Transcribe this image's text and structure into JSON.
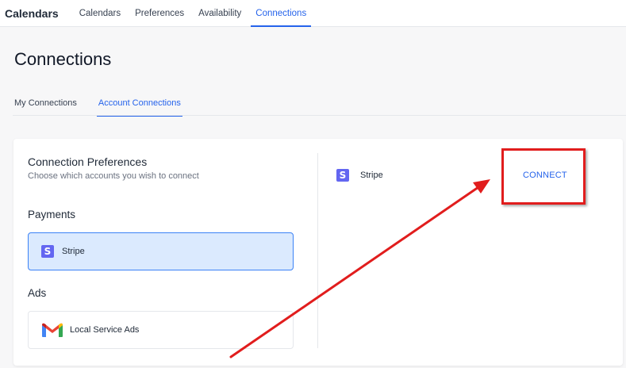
{
  "app": {
    "title": "Calendars"
  },
  "topnav": {
    "tabs": [
      {
        "label": "Calendars",
        "active": false
      },
      {
        "label": "Preferences",
        "active": false
      },
      {
        "label": "Availability",
        "active": false
      },
      {
        "label": "Connections",
        "active": true
      }
    ]
  },
  "page": {
    "title": "Connections"
  },
  "subtabs": [
    {
      "label": "My Connections",
      "active": false
    },
    {
      "label": "Account Connections",
      "active": true
    }
  ],
  "preferences": {
    "title": "Connection Preferences",
    "subtitle": "Choose which accounts you wish to connect",
    "sections": [
      {
        "label": "Payments",
        "options": [
          {
            "label": "Stripe",
            "icon": "stripe-icon",
            "selected": true
          }
        ]
      },
      {
        "label": "Ads",
        "options": [
          {
            "label": "Local Service Ads",
            "icon": "gmail-icon",
            "selected": false
          }
        ]
      }
    ]
  },
  "detail": {
    "provider": "Stripe",
    "icon": "stripe-icon",
    "connect_label": "CONNECT"
  },
  "colors": {
    "accent": "#2563eb",
    "stripe": "#6366f1",
    "selected_bg": "#dbeafe",
    "annotation": "#e11d1d"
  }
}
